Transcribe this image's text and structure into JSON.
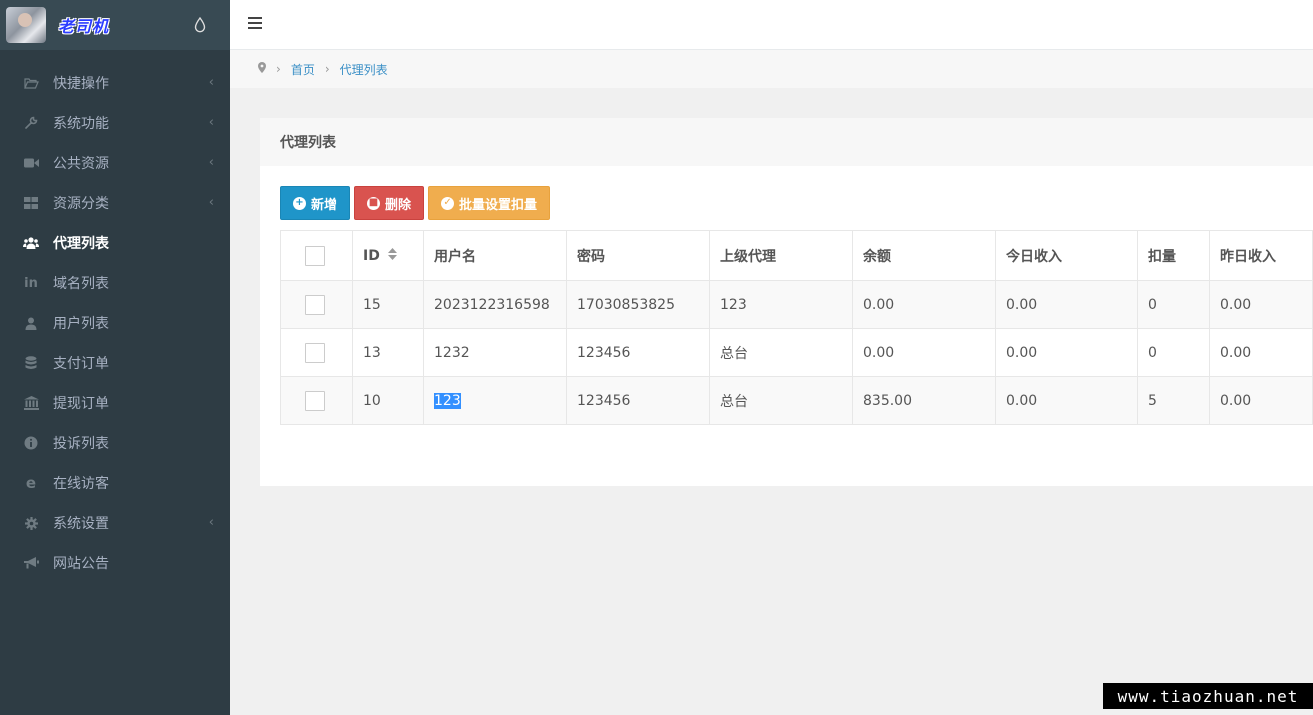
{
  "brand": {
    "title": "老司机"
  },
  "sidebar": {
    "items": [
      {
        "label": "快捷操作",
        "icon": "folder-open-icon",
        "has_arrow": true,
        "active": false
      },
      {
        "label": "系统功能",
        "icon": "wrench-icon",
        "has_arrow": true,
        "active": false
      },
      {
        "label": "公共资源",
        "icon": "video-camera-icon",
        "has_arrow": true,
        "active": false
      },
      {
        "label": "资源分类",
        "icon": "th-large-icon",
        "has_arrow": true,
        "active": false
      },
      {
        "label": "代理列表",
        "icon": "users-icon",
        "has_arrow": false,
        "active": true
      },
      {
        "label": "域名列表",
        "icon": "linkedin-icon",
        "has_arrow": false,
        "active": false
      },
      {
        "label": "用户列表",
        "icon": "user-icon",
        "has_arrow": false,
        "active": false
      },
      {
        "label": "支付订单",
        "icon": "database-icon",
        "has_arrow": false,
        "active": false
      },
      {
        "label": "提现订单",
        "icon": "bank-icon",
        "has_arrow": false,
        "active": false
      },
      {
        "label": "投诉列表",
        "icon": "info-circle-icon",
        "has_arrow": false,
        "active": false
      },
      {
        "label": "在线访客",
        "icon": "internet-explorer-icon",
        "has_arrow": false,
        "active": false
      },
      {
        "label": "系统设置",
        "icon": "gear-icon",
        "has_arrow": true,
        "active": false
      },
      {
        "label": "网站公告",
        "icon": "bullhorn-icon",
        "has_arrow": false,
        "active": false
      }
    ]
  },
  "breadcrumb": {
    "home": "首页",
    "current": "代理列表"
  },
  "card": {
    "title": "代理列表",
    "buttons": {
      "add": "新增",
      "delete": "删除",
      "batch": "批量设置扣量"
    }
  },
  "table": {
    "headers": [
      "ID",
      "用户名",
      "密码",
      "上级代理",
      "余额",
      "今日收入",
      "扣量",
      "昨日收入"
    ],
    "rows": [
      [
        "15",
        "2023122316598",
        "17030853825",
        "123",
        "0.00",
        "0.00",
        "0",
        "0.00"
      ],
      [
        "13",
        "1232",
        "123456",
        "总台",
        "0.00",
        "0.00",
        "0",
        "0.00"
      ],
      [
        "10",
        "123",
        "123456",
        "总台",
        "835.00",
        "0.00",
        "5",
        "0.00"
      ]
    ]
  },
  "watermark": "www.tiaozhuan.net",
  "colors": {
    "sidebar_bg": "#2e3c44",
    "accent_blue": "#1f95c9",
    "danger": "#d9534f",
    "warning": "#f0ad4e",
    "link": "#3a8fc6"
  }
}
